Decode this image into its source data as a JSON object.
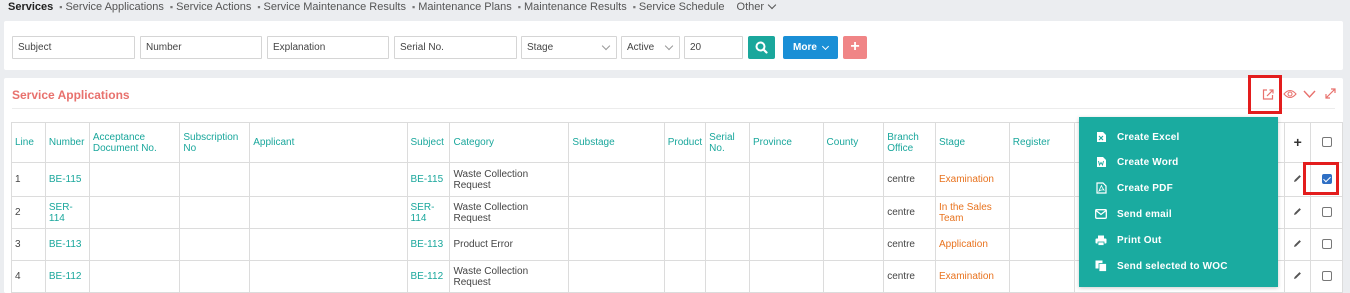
{
  "nav": {
    "items": [
      {
        "label": "Services",
        "active": true
      },
      {
        "label": "Service Applications"
      },
      {
        "label": "Service Actions"
      },
      {
        "label": "Service Maintenance Results"
      },
      {
        "label": "Maintenance Plans"
      },
      {
        "label": "Maintenance Results"
      },
      {
        "label": "Service Schedule"
      }
    ],
    "other_label": "Other"
  },
  "filters": {
    "subject": "Subject",
    "number": "Number",
    "explanation": "Explanation",
    "serial_no": "Serial No.",
    "stage": "Stage",
    "status": "Active",
    "page_size": "20",
    "more_label": "More",
    "add_label": "+"
  },
  "list": {
    "title": "Service Applications",
    "columns": [
      "Line",
      "Number",
      "Acceptance Document No.",
      "Subscription No",
      "Applicant",
      "Subject",
      "Category",
      "Substage",
      "Product",
      "Serial No.",
      "Province",
      "County",
      "Branch Office",
      "Stage",
      "Register",
      "",
      "+",
      ""
    ],
    "rows": [
      {
        "line": "1",
        "number": "BE-115",
        "acceptance": "",
        "subscription": "",
        "applicant": "",
        "subject": "BE-115",
        "category": "Waste Collection Request",
        "substage": "",
        "product": "",
        "serial": "",
        "province": "",
        "county": "",
        "branch": "centre",
        "stage": "Examination",
        "register": "",
        "checked": true
      },
      {
        "line": "2",
        "number": "SER-114",
        "acceptance": "",
        "subscription": "",
        "applicant": "",
        "subject": "SER-114",
        "category": "Waste Collection Request",
        "substage": "",
        "product": "",
        "serial": "",
        "province": "",
        "county": "",
        "branch": "centre",
        "stage": "In the Sales Team",
        "register": "",
        "checked": false
      },
      {
        "line": "3",
        "number": "BE-113",
        "acceptance": "",
        "subscription": "",
        "applicant": "",
        "subject": "BE-113",
        "category": "Product Error",
        "substage": "",
        "product": "",
        "serial": "",
        "province": "",
        "county": "",
        "branch": "centre",
        "stage": "Application",
        "register": "",
        "checked": false
      },
      {
        "line": "4",
        "number": "BE-112",
        "acceptance": "",
        "subscription": "",
        "applicant": "",
        "subject": "BE-112",
        "category": "Waste Collection Request",
        "substage": "",
        "product": "",
        "serial": "",
        "province": "",
        "county": "",
        "branch": "centre",
        "stage": "Examination",
        "register": "",
        "checked": false
      }
    ]
  },
  "export_menu": {
    "items": [
      {
        "label": "Create Excel",
        "icon": "excel-file-icon"
      },
      {
        "label": "Create Word",
        "icon": "word-file-icon"
      },
      {
        "label": "Create PDF",
        "icon": "pdf-file-icon"
      },
      {
        "label": "Send email",
        "icon": "envelope-icon"
      },
      {
        "label": "Print Out",
        "icon": "printer-icon"
      },
      {
        "label": "Send selected to WOC",
        "icon": "copy-icon"
      }
    ]
  },
  "colors": {
    "teal": "#1aa79c",
    "blue": "#1a8fd6",
    "salmon": "#e8716d",
    "stage_orange": "#e8731f",
    "highlight_red": "#e31d1d"
  }
}
